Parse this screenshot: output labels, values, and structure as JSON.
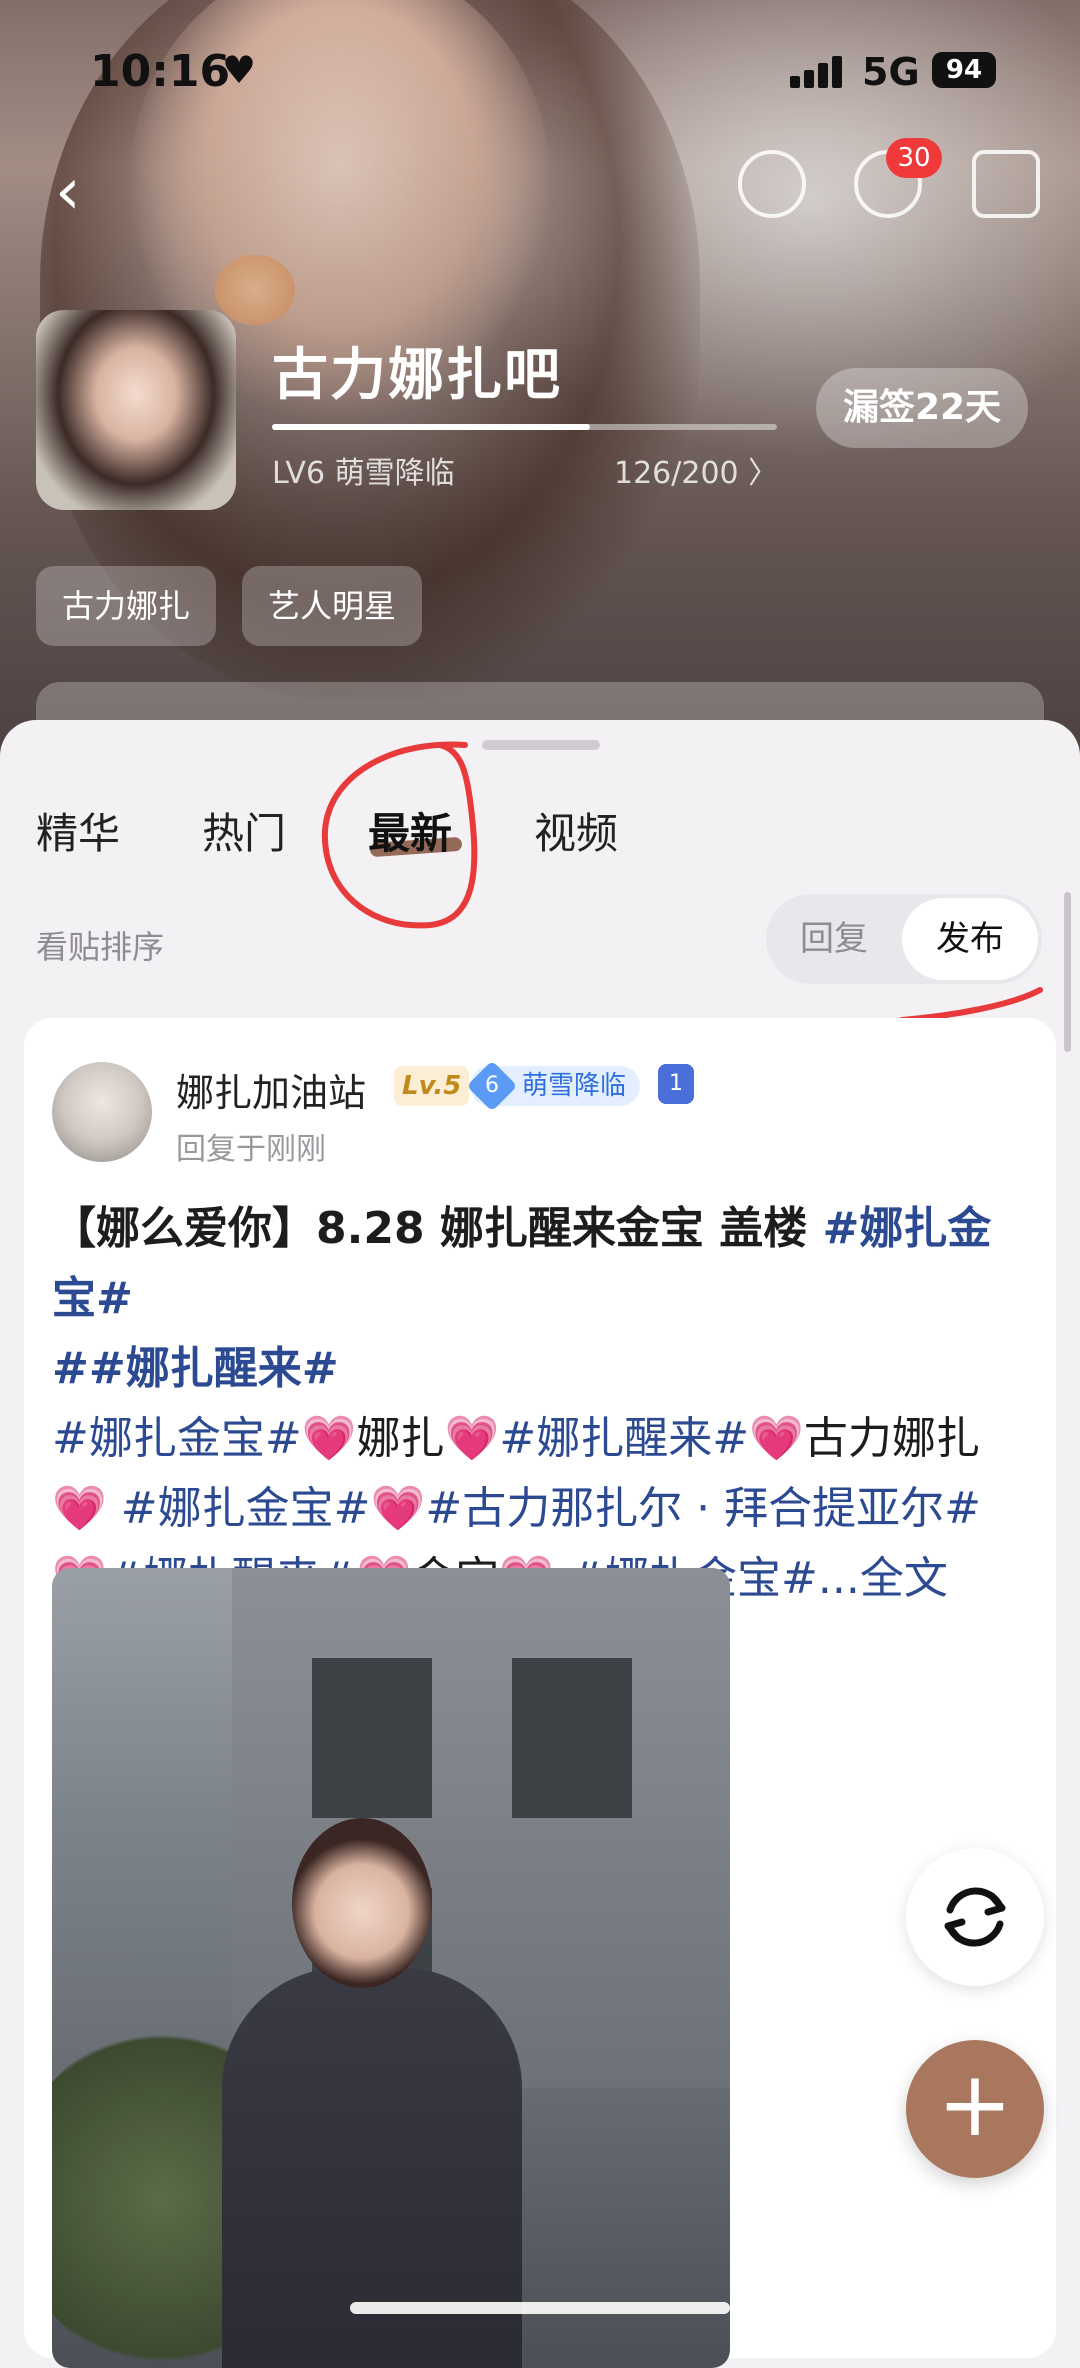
{
  "status_bar": {
    "time": "10:16",
    "network": "5G",
    "battery": "94"
  },
  "header": {
    "notification_count": "30"
  },
  "forum": {
    "name": "古力娜扎吧",
    "level": "LV6 萌雪降临",
    "exp": "126/200 〉",
    "exp_progress": 0.63,
    "sign_label": "漏签22天",
    "tags": [
      "古力娜扎",
      "艺人明星"
    ]
  },
  "tabs": [
    {
      "label": "精华"
    },
    {
      "label": "热门"
    },
    {
      "label": "最新",
      "active": true
    },
    {
      "label": "视频"
    }
  ],
  "sort": {
    "label": "看贴排序",
    "options": [
      "回复",
      "发布"
    ],
    "selected": "发布"
  },
  "post": {
    "author": "娜扎加油站",
    "level_badge": "Lv.5",
    "honor_level": "6",
    "honor_title": "萌雪降临",
    "medal": "1",
    "time": "回复于刚刚",
    "title_text": "【娜么爱你】8.28 娜扎醒来金宝 盖楼 ",
    "tag1": "#娜扎金宝#",
    "tag2": "##娜扎醒来#",
    "line2_a": "#娜扎金宝#",
    "line2_b": "娜扎",
    "line2_c": "#娜扎醒来#",
    "line2_d": "古力娜扎",
    "line3_a": " #娜扎金宝#",
    "line3_b": "#古力那扎尔 · 拜合提亚尔#",
    "line4_a": "#娜扎醒来#",
    "line4_b": "金宝",
    "line4_c": " #娜扎金宝#",
    "more": "...全文",
    "heart": "💗"
  },
  "colors": {
    "accent": "#a8775e",
    "tag": "#2c4a91",
    "badge_red": "#f03a3a"
  }
}
